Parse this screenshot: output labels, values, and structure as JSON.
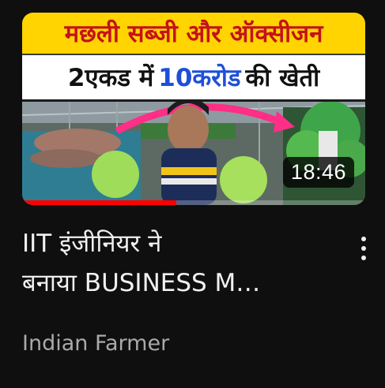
{
  "video": {
    "thumbnail": {
      "headline_line1": "मछली सब्जी और ऑक्सीजन",
      "headline_line2_part1": "2एकड में",
      "headline_line2_highlight": "10करोड",
      "headline_line2_part2": "की खेती",
      "duration": "18:46",
      "watched_progress": 0.45,
      "colors": {
        "banner_yellow": "#ffd400",
        "banner_red_text": "#c4121b",
        "highlight_blue": "#1f4fd8",
        "progress_red": "#ff0000"
      }
    },
    "title_line1": "IIT इंजीनियर ने",
    "title_line2": "बनाया BUSINESS M…",
    "channel_name": "Indian Farmer",
    "menu_icon": "vertical-ellipsis-icon"
  }
}
